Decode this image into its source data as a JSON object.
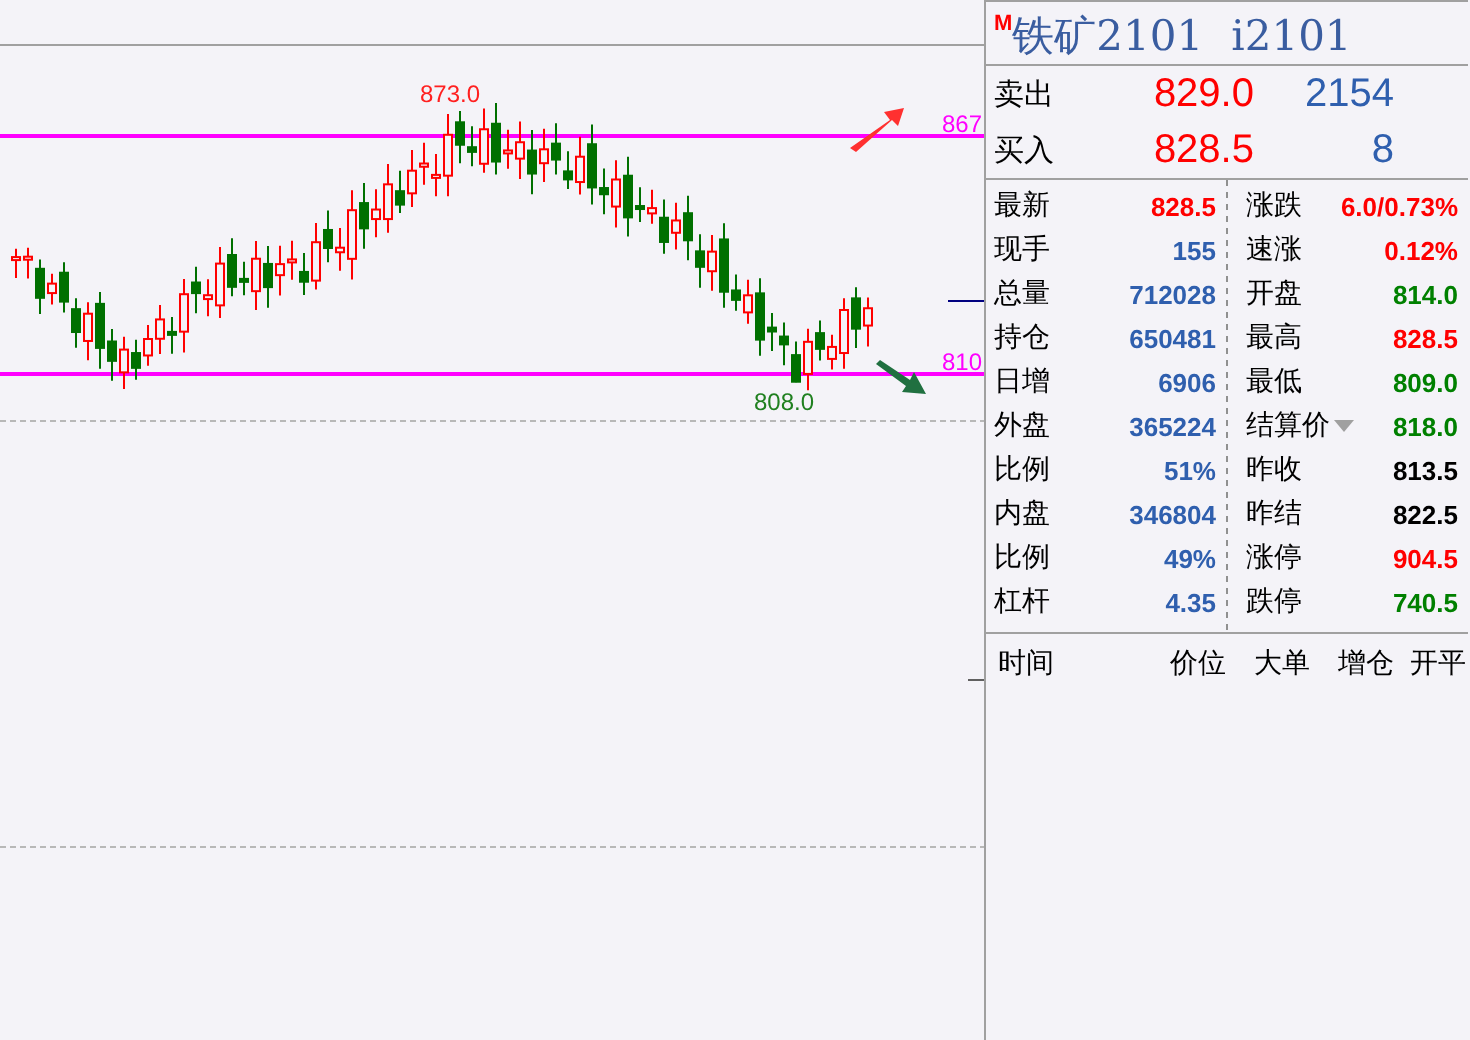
{
  "chart": {
    "high_label": "873.0",
    "low_label": "808.0",
    "upper_line_label": "867",
    "lower_line_label": "810"
  },
  "quote": {
    "badge": "M",
    "name": "铁矿2101",
    "code": "i2101",
    "ask": {
      "label": "卖出",
      "price": "829.0",
      "volume": "2154"
    },
    "bid": {
      "label": "买入",
      "price": "828.5",
      "volume": "8"
    }
  },
  "stats": [
    {
      "label": "最新",
      "value": "828.5",
      "color": "#ff0000"
    },
    {
      "label": "涨跌",
      "value": "6.0/0.73%",
      "color": "#ff0000"
    },
    {
      "label": "现手",
      "value": "155",
      "color": "#2f5fae"
    },
    {
      "label": "速涨",
      "value": "0.12%",
      "color": "#ff0000"
    },
    {
      "label": "总量",
      "value": "712028",
      "color": "#2f5fae"
    },
    {
      "label": "开盘",
      "value": "814.0",
      "color": "#008000"
    },
    {
      "label": "持仓",
      "value": "650481",
      "color": "#2f5fae"
    },
    {
      "label": "最高",
      "value": "828.5",
      "color": "#ff0000"
    },
    {
      "label": "日增",
      "value": "6906",
      "color": "#2f5fae"
    },
    {
      "label": "最低",
      "value": "809.0",
      "color": "#008000"
    },
    {
      "label": "外盘",
      "value": "365224",
      "color": "#2f5fae"
    },
    {
      "label": "结算价",
      "dropdown": true,
      "value": "818.0",
      "color": "#008000"
    },
    {
      "label": "比例",
      "value": "51%",
      "color": "#2f5fae"
    },
    {
      "label": "昨收",
      "value": "813.5",
      "color": "#000000"
    },
    {
      "label": "内盘",
      "value": "346804",
      "color": "#2f5fae"
    },
    {
      "label": "昨结",
      "value": "822.5",
      "color": "#000000"
    },
    {
      "label": "比例",
      "value": "49%",
      "color": "#2f5fae"
    },
    {
      "label": "涨停",
      "value": "904.5",
      "color": "#ff0000"
    },
    {
      "label": "杠杆",
      "value": "4.35",
      "color": "#2f5fae"
    },
    {
      "label": "跌停",
      "value": "740.5",
      "color": "#008000"
    }
  ],
  "trades_columns": [
    "时间",
    "价位",
    "大单",
    "增仓",
    "开平"
  ]
}
